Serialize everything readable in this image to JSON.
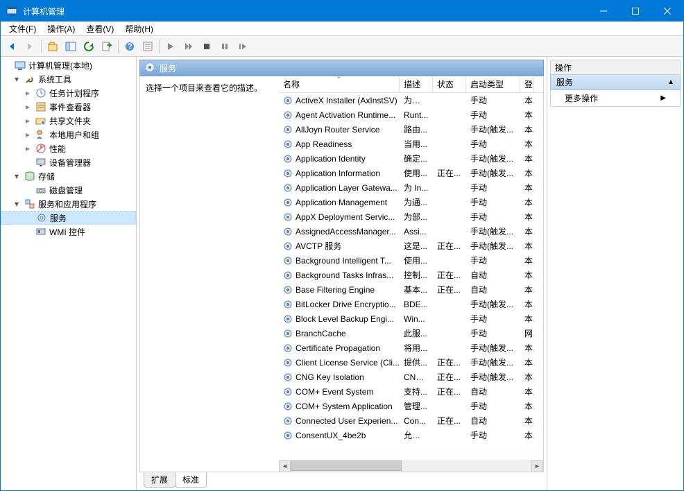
{
  "window": {
    "title": "计算机管理"
  },
  "menus": {
    "file": "文件(F)",
    "action": "操作(A)",
    "view": "查看(V)",
    "help": "帮助(H)"
  },
  "tree": {
    "root": "计算机管理(本地)",
    "system_tools": "系统工具",
    "task_scheduler": "任务计划程序",
    "event_viewer": "事件查看器",
    "shared_folders": "共享文件夹",
    "local_users": "本地用户和组",
    "performance": "性能",
    "device_manager": "设备管理器",
    "storage": "存储",
    "disk_mgmt": "磁盘管理",
    "services_apps": "服务和应用程序",
    "services": "服务",
    "wmi": "WMI 控件"
  },
  "center": {
    "header": "服务",
    "desc_hint": "选择一个项目来查看它的描述。",
    "columns": {
      "name": "名称",
      "desc": "描述",
      "status": "状态",
      "startup": "启动类型",
      "logon": "登"
    },
    "tabs": {
      "extended": "扩展",
      "standard": "标准"
    }
  },
  "actions": {
    "header": "操作",
    "sub": "服务",
    "more": "更多操作"
  },
  "services": [
    {
      "name": "ActiveX Installer (AxInstSV)",
      "desc": "为从 ...",
      "status": "",
      "startup": "手动",
      "logon": "本"
    },
    {
      "name": "Agent Activation Runtime...",
      "desc": "Runt...",
      "status": "",
      "startup": "手动",
      "logon": "本"
    },
    {
      "name": "AllJoyn Router Service",
      "desc": "路由...",
      "status": "",
      "startup": "手动(触发...",
      "logon": "本"
    },
    {
      "name": "App Readiness",
      "desc": "当用...",
      "status": "",
      "startup": "手动",
      "logon": "本"
    },
    {
      "name": "Application Identity",
      "desc": "确定...",
      "status": "",
      "startup": "手动(触发...",
      "logon": "本"
    },
    {
      "name": "Application Information",
      "desc": "使用...",
      "status": "正在...",
      "startup": "手动(触发...",
      "logon": "本"
    },
    {
      "name": "Application Layer Gatewa...",
      "desc": "为 In...",
      "status": "",
      "startup": "手动",
      "logon": "本"
    },
    {
      "name": "Application Management",
      "desc": "为通...",
      "status": "",
      "startup": "手动",
      "logon": "本"
    },
    {
      "name": "AppX Deployment Servic...",
      "desc": "为部...",
      "status": "",
      "startup": "手动",
      "logon": "本"
    },
    {
      "name": "AssignedAccessManager...",
      "desc": "Assi...",
      "status": "",
      "startup": "手动(触发...",
      "logon": "本"
    },
    {
      "name": "AVCTP 服务",
      "desc": "这是...",
      "status": "正在...",
      "startup": "手动(触发...",
      "logon": "本"
    },
    {
      "name": "Background Intelligent T...",
      "desc": "使用...",
      "status": "",
      "startup": "手动",
      "logon": "本"
    },
    {
      "name": "Background Tasks Infras...",
      "desc": "控制...",
      "status": "正在...",
      "startup": "自动",
      "logon": "本"
    },
    {
      "name": "Base Filtering Engine",
      "desc": "基本...",
      "status": "正在...",
      "startup": "自动",
      "logon": "本"
    },
    {
      "name": "BitLocker Drive Encryptio...",
      "desc": "BDE...",
      "status": "",
      "startup": "手动(触发...",
      "logon": "本"
    },
    {
      "name": "Block Level Backup Engi...",
      "desc": "Win...",
      "status": "",
      "startup": "手动",
      "logon": "本"
    },
    {
      "name": "BranchCache",
      "desc": "此服...",
      "status": "",
      "startup": "手动",
      "logon": "网"
    },
    {
      "name": "Certificate Propagation",
      "desc": "将用...",
      "status": "",
      "startup": "手动(触发...",
      "logon": "本"
    },
    {
      "name": "Client License Service (Cli...",
      "desc": "提供...",
      "status": "正在...",
      "startup": "手动(触发...",
      "logon": "本"
    },
    {
      "name": "CNG Key Isolation",
      "desc": "CNG...",
      "status": "正在...",
      "startup": "手动(触发...",
      "logon": "本"
    },
    {
      "name": "COM+ Event System",
      "desc": "支持...",
      "status": "正在...",
      "startup": "自动",
      "logon": "本"
    },
    {
      "name": "COM+ System Application",
      "desc": "管理...",
      "status": "",
      "startup": "手动",
      "logon": "本"
    },
    {
      "name": "Connected User Experien...",
      "desc": "Con...",
      "status": "正在...",
      "startup": "自动",
      "logon": "本"
    },
    {
      "name": "ConsentUX_4be2b",
      "desc": "允许 ...",
      "status": "",
      "startup": "手动",
      "logon": "本"
    }
  ]
}
